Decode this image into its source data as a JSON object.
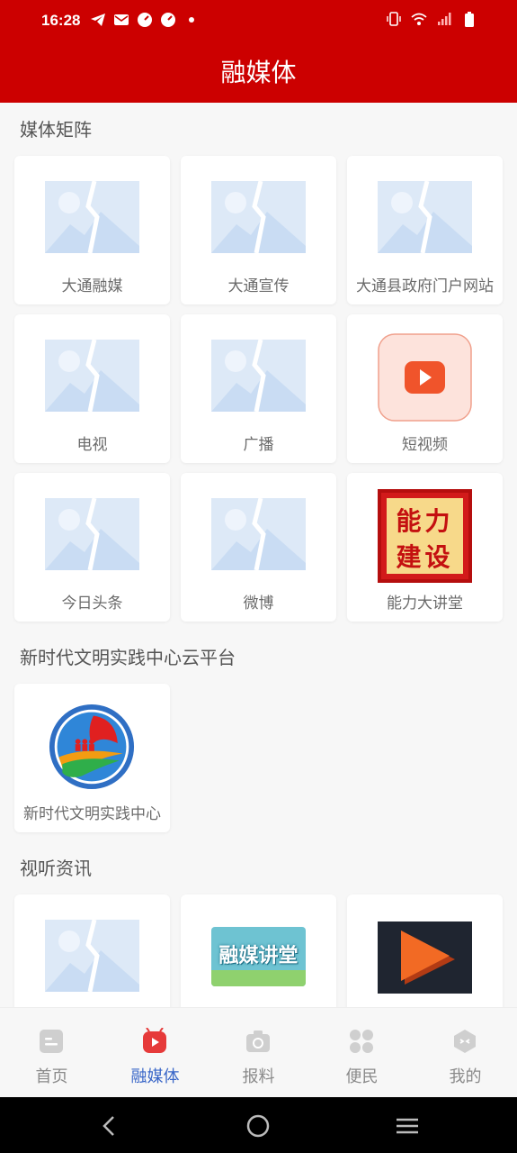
{
  "status_bar": {
    "time": "16:28"
  },
  "page_title": "融媒体",
  "sections": {
    "media_matrix": "媒体矩阵",
    "civilization": "新时代文明实践中心云平台",
    "av_news": "视听资讯"
  },
  "media_items": [
    {
      "label": "大通融媒",
      "icon": "image-placeholder-icon"
    },
    {
      "label": "大通宣传",
      "icon": "image-placeholder-icon"
    },
    {
      "label": "大通县政府门户网站",
      "icon": "image-placeholder-icon"
    },
    {
      "label": "电视",
      "icon": "image-placeholder-icon"
    },
    {
      "label": "广播",
      "icon": "image-placeholder-icon"
    },
    {
      "label": "短视频",
      "icon": "video-play-icon"
    },
    {
      "label": "今日头条",
      "icon": "image-placeholder-icon"
    },
    {
      "label": "微博",
      "icon": "image-placeholder-icon"
    },
    {
      "label": "能力大讲堂",
      "icon": "ability-building-logo"
    }
  ],
  "ability_logo_text": {
    "line1": "能力",
    "line2": "建设"
  },
  "civilization_items": [
    {
      "label": "新时代文明实践中心",
      "icon": "civilization-center-logo"
    }
  ],
  "news_items": [
    {
      "icon": "image-placeholder-icon"
    },
    {
      "icon": "rongmei-lecture-banner",
      "banner_text": "融媒讲堂"
    },
    {
      "icon": "video-play-thumb"
    }
  ],
  "bottom_nav": [
    {
      "label": "首页",
      "icon": "home-icon"
    },
    {
      "label": "融媒体",
      "icon": "media-play-icon",
      "active": true
    },
    {
      "label": "报料",
      "icon": "camera-icon"
    },
    {
      "label": "便民",
      "icon": "grid-icon"
    },
    {
      "label": "我的",
      "icon": "profile-icon"
    }
  ],
  "colors": {
    "brand_red": "#cc0000",
    "active_blue": "#3a67c8",
    "placeholder": "#dde9f7"
  }
}
